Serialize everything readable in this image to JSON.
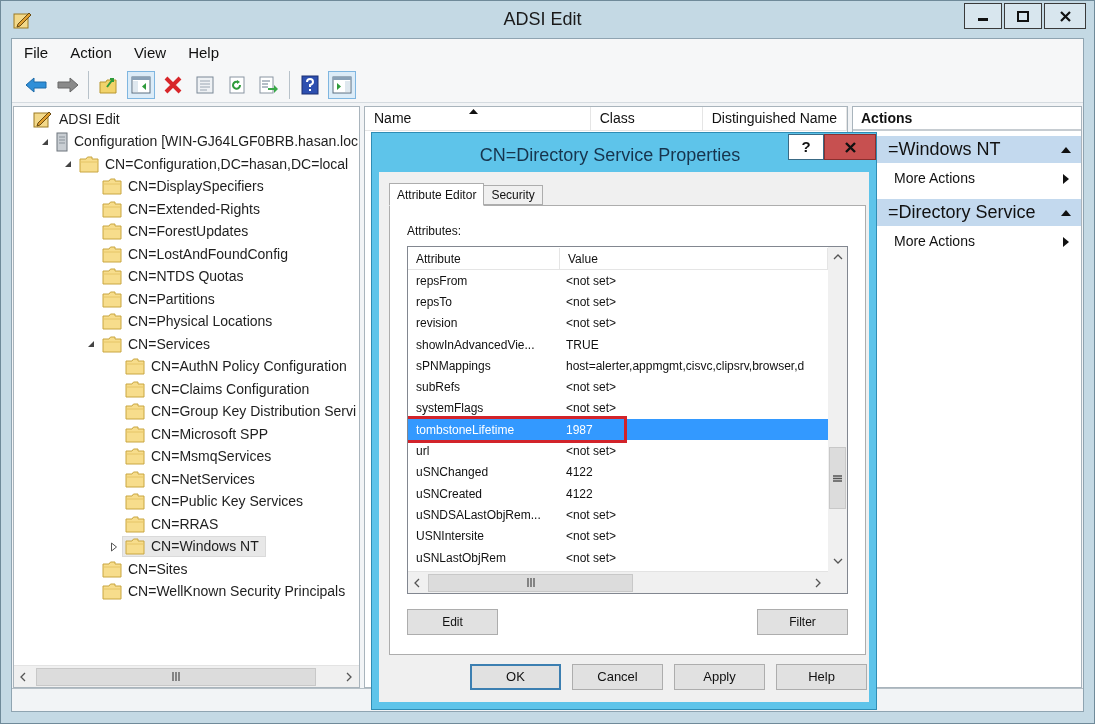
{
  "window": {
    "title": "ADSI Edit"
  },
  "menu": [
    "File",
    "Action",
    "View",
    "Help"
  ],
  "toolbar_groups": [
    [
      {
        "kind": "back",
        "pressed": false
      },
      {
        "kind": "forward",
        "pressed": false
      }
    ],
    [
      {
        "kind": "up",
        "pressed": false
      },
      {
        "kind": "console-tree",
        "pressed": true
      },
      {
        "kind": "delete",
        "pressed": false
      },
      {
        "kind": "properties",
        "pressed": false
      },
      {
        "kind": "refresh",
        "pressed": false
      },
      {
        "kind": "export",
        "pressed": false
      }
    ],
    [
      {
        "kind": "help",
        "pressed": false
      },
      {
        "kind": "action-pane",
        "pressed": true
      }
    ]
  ],
  "tree": {
    "items": [
      {
        "label": "ADSI Edit",
        "kind": "root",
        "selected": false,
        "children": [
          {
            "label": "Configuration [WIN-GJ64LGF0BRB.hasan.loc",
            "kind": "server",
            "expanded": true,
            "selected": false,
            "children": [
              {
                "label": "CN=Configuration,DC=hasan,DC=local",
                "kind": "folder",
                "expanded": true,
                "selected": false,
                "children": [
                  {
                    "label": "CN=DisplaySpecifiers",
                    "kind": "folder",
                    "selected": false
                  },
                  {
                    "label": "CN=Extended-Rights",
                    "kind": "folder",
                    "selected": false
                  },
                  {
                    "label": "CN=ForestUpdates",
                    "kind": "folder",
                    "selected": false
                  },
                  {
                    "label": "CN=LostAndFoundConfig",
                    "kind": "folder",
                    "selected": false
                  },
                  {
                    "label": "CN=NTDS Quotas",
                    "kind": "folder",
                    "selected": false
                  },
                  {
                    "label": "CN=Partitions",
                    "kind": "folder",
                    "selected": false
                  },
                  {
                    "label": "CN=Physical Locations",
                    "kind": "folder",
                    "selected": false
                  },
                  {
                    "label": "CN=Services",
                    "kind": "folder",
                    "expanded": true,
                    "selected": false,
                    "children": [
                      {
                        "label": "CN=AuthN Policy Configuration",
                        "kind": "folder",
                        "selected": false
                      },
                      {
                        "label": "CN=Claims Configuration",
                        "kind": "folder",
                        "selected": false
                      },
                      {
                        "label": "CN=Group Key Distribution Servi",
                        "kind": "folder",
                        "selected": false
                      },
                      {
                        "label": "CN=Microsoft SPP",
                        "kind": "folder",
                        "selected": false
                      },
                      {
                        "label": "CN=MsmqServices",
                        "kind": "folder",
                        "selected": false
                      },
                      {
                        "label": "CN=NetServices",
                        "kind": "folder",
                        "selected": false
                      },
                      {
                        "label": "CN=Public Key Services",
                        "kind": "folder",
                        "selected": false
                      },
                      {
                        "label": "CN=RRAS",
                        "kind": "folder",
                        "selected": false
                      },
                      {
                        "label": "CN=Windows NT",
                        "kind": "folder",
                        "expanded": false,
                        "selected": true
                      }
                    ]
                  },
                  {
                    "label": "CN=Sites",
                    "kind": "folder",
                    "selected": false
                  },
                  {
                    "label": "CN=WellKnown Security Principals",
                    "kind": "folder",
                    "selected": false
                  }
                ]
              }
            ]
          }
        ]
      }
    ]
  },
  "list": {
    "columns": [
      {
        "label": "Name",
        "sorted": true
      },
      {
        "label": "Class",
        "sorted": false
      },
      {
        "label": "Distinguished Name",
        "sorted": false
      }
    ]
  },
  "actions": {
    "title": "Actions",
    "sections": [
      {
        "title": "=Windows NT",
        "expanded": true,
        "items": [
          "More Actions"
        ]
      },
      {
        "title": "=Directory Service",
        "expanded": true,
        "items": [
          "More Actions"
        ]
      }
    ]
  },
  "dialog": {
    "title": "CN=Directory Service Properties",
    "help_button": "?",
    "tabs": [
      {
        "label": "Attribute Editor",
        "selected": true
      },
      {
        "label": "Security",
        "selected": false
      }
    ],
    "attributes_label": "Attributes:",
    "columns": [
      "Attribute",
      "Value"
    ],
    "rows": [
      {
        "attribute": "repsFrom",
        "value": "<not set>",
        "selected": false,
        "highlighted": false
      },
      {
        "attribute": "repsTo",
        "value": "<not set>",
        "selected": false,
        "highlighted": false
      },
      {
        "attribute": "revision",
        "value": "<not set>",
        "selected": false,
        "highlighted": false
      },
      {
        "attribute": "showInAdvancedVie...",
        "value": "TRUE",
        "selected": false,
        "highlighted": false
      },
      {
        "attribute": "sPNMappings",
        "value": "host=alerter,appmgmt,cisvc,clipsrv,browser,d",
        "selected": false,
        "highlighted": false
      },
      {
        "attribute": "subRefs",
        "value": "<not set>",
        "selected": false,
        "highlighted": false
      },
      {
        "attribute": "systemFlags",
        "value": "<not set>",
        "selected": false,
        "highlighted": false
      },
      {
        "attribute": "tombstoneLifetime",
        "value": "1987",
        "selected": true,
        "highlighted": true
      },
      {
        "attribute": "url",
        "value": "<not set>",
        "selected": false,
        "highlighted": false
      },
      {
        "attribute": "uSNChanged",
        "value": "4122",
        "selected": false,
        "highlighted": false
      },
      {
        "attribute": "uSNCreated",
        "value": "4122",
        "selected": false,
        "highlighted": false
      },
      {
        "attribute": "uSNDSALastObjRem...",
        "value": "<not set>",
        "selected": false,
        "highlighted": false
      },
      {
        "attribute": "USNIntersite",
        "value": "<not set>",
        "selected": false,
        "highlighted": false
      },
      {
        "attribute": "uSNLastObjRem",
        "value": "<not set>",
        "selected": false,
        "highlighted": false
      }
    ],
    "edit_button": "Edit",
    "filter_button": "Filter",
    "footer_buttons": [
      {
        "label": "OK",
        "default": true
      },
      {
        "label": "Cancel",
        "default": false
      },
      {
        "label": "Apply",
        "default": false
      },
      {
        "label": "Help",
        "default": false
      }
    ]
  }
}
